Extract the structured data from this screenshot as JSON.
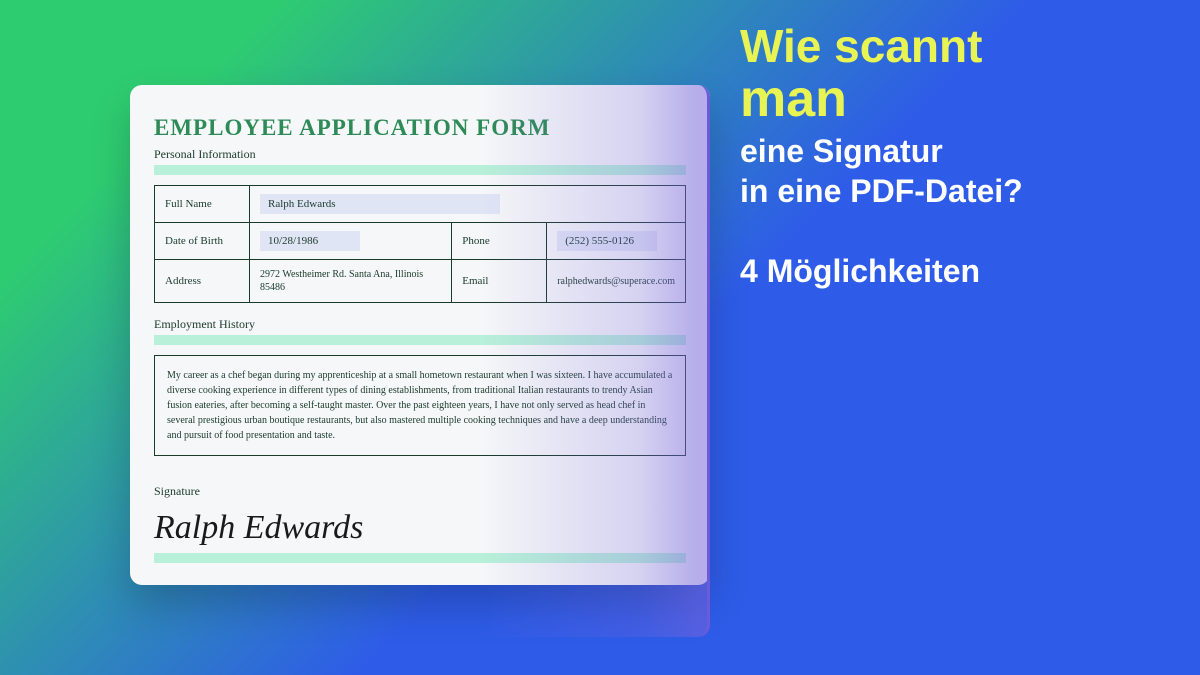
{
  "form": {
    "title": "EMPLOYEE APPLICATION FORM",
    "section_personal": "Personal Information",
    "section_history": "Employment History",
    "signature_label": "Signature",
    "signature_value": "Ralph Edwards",
    "fields": {
      "full_name_label": "Full Name",
      "full_name_value": "Ralph Edwards",
      "dob_label": "Date of Birth",
      "dob_value": "10/28/1986",
      "phone_label": "Phone",
      "phone_value": "(252) 555-0126",
      "address_label": "Address",
      "address_value": "2972 Westheimer Rd. Santa Ana, Illinois 85486",
      "email_label": "Email",
      "email_value": "ralphedwards@superace.com"
    },
    "history_text": "My career as a chef began during my apprenticeship at a small hometown restaurant when I was sixteen. I have accumulated a diverse cooking experience in different types of dining establishments, from traditional Italian restaurants to trendy Asian fusion eateries, after becoming a self-taught master. Over the past eighteen years, I have not only served as head chef in several prestigious urban boutique restaurants, but also mastered multiple cooking techniques and have a deep understanding and pursuit of food presentation and taste."
  },
  "headline": {
    "line1": "Wie scannt",
    "line2": "man",
    "line3": "eine Signatur",
    "line4": "in eine PDF-Datei?",
    "line5": "4 Möglichkeiten"
  }
}
